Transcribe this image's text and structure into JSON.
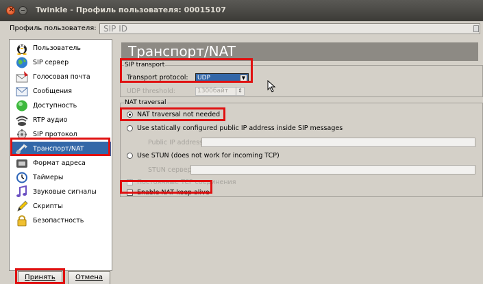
{
  "window": {
    "title": "Twinkle - Профиль пользователя: 00015107"
  },
  "profile": {
    "label": "Профиль пользователя:",
    "value": "SIP ID"
  },
  "sidebar": {
    "items": [
      {
        "label": "Пользователь",
        "icon": "user-icon"
      },
      {
        "label": "SIP сервер",
        "icon": "globe-icon"
      },
      {
        "label": "Голосовая почта",
        "icon": "voicemail-icon"
      },
      {
        "label": "Сообщения",
        "icon": "envelope-icon"
      },
      {
        "label": "Доступность",
        "icon": "presence-icon"
      },
      {
        "label": "RTP аудио",
        "icon": "audio-icon"
      },
      {
        "label": "SIP протокол",
        "icon": "protocol-icon"
      },
      {
        "label": "Транспорт/NAT",
        "icon": "transport-icon"
      },
      {
        "label": "Формат адреса",
        "icon": "address-icon"
      },
      {
        "label": "Таймеры",
        "icon": "clock-icon"
      },
      {
        "label": "Звуковые сигналы",
        "icon": "music-note-icon"
      },
      {
        "label": "Скрипты",
        "icon": "pencil-icon"
      },
      {
        "label": "Безопастность",
        "icon": "lock-icon"
      }
    ],
    "selected": "Транспорт/NAT"
  },
  "buttons": {
    "ok": "Принять",
    "cancel": "Отмена"
  },
  "main": {
    "heading": "Транспорт/NAT",
    "sip_transport": {
      "title": "SIP transport",
      "protocol_label": "Transport protocol:",
      "protocol_value": "UDP",
      "threshold_label": "UDP threshold:",
      "threshold_value": "1300байт"
    },
    "nat": {
      "title": "NAT traversal",
      "opt_none": "NAT traversal not needed",
      "opt_static": "Use statically configured public IP address inside SIP messages",
      "public_ip_label": "Public IP address:",
      "public_ip_value": "",
      "opt_stun": "Use STUN (does not work for incoming TCP)",
      "stun_label": "STUN сервер:",
      "stun_value": "",
      "persistent_tcp": "Постоянные TCP соединения",
      "keep_alive": "Enable NAT keep alive"
    }
  },
  "colors": {
    "highlight": "#e01010",
    "selection": "#3367a8",
    "titlebar": "#3c3b37"
  }
}
